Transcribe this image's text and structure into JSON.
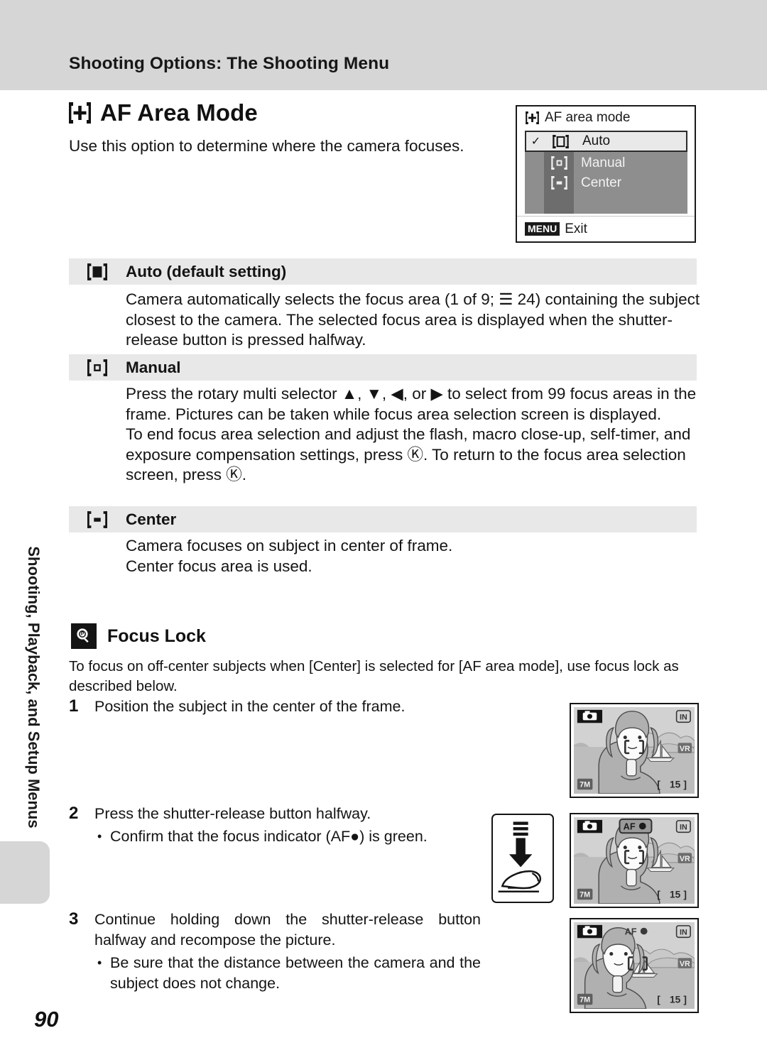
{
  "header": {
    "title": "Shooting Options: The Shooting Menu"
  },
  "sidebar": {
    "vertical_label": "Shooting, Playback, and Setup Menus"
  },
  "page_number": "90",
  "main": {
    "title": "AF Area Mode",
    "title_icon": "af-area-bracket-plus-icon",
    "intro": "Use this option to determine where the camera focuses."
  },
  "camera_menu": {
    "title": "AF area mode",
    "title_icon": "af-area-bracket-plus-icon",
    "items": [
      {
        "label": "Auto",
        "icon": "bracket-large-square-icon",
        "selected": true,
        "check": "✓"
      },
      {
        "label": "Manual",
        "icon": "bracket-small-square-icon",
        "selected": false,
        "check": ""
      },
      {
        "label": "Center",
        "icon": "bracket-dot-rect-icon",
        "selected": false,
        "check": ""
      }
    ],
    "footer_badge": "MENU",
    "footer_label": "Exit"
  },
  "options": [
    {
      "icon": "bracket-filled-square-icon",
      "heading": "Auto (default setting)",
      "body": "Camera automatically selects the focus area (1 of 9; ☰ 24) containing the subject closest to the camera. The selected focus area is displayed when the shutter-release button is pressed halfway."
    },
    {
      "icon": "bracket-small-square-icon",
      "heading": "Manual",
      "body_1": "Press the rotary multi selector ▲, ▼, ◀, or ▶ to select from 99 focus areas in the frame. Pictures can be taken while focus area selection screen is displayed.",
      "body_2": "To end focus area selection and adjust the flash, macro close-up, self-timer, and exposure compensation settings, press Ⓚ. To return to the focus area selection screen, press Ⓚ."
    },
    {
      "icon": "bracket-dot-rect-icon",
      "heading": "Center",
      "body_1": "Camera focuses on subject in center of frame.",
      "body_2": "Center focus area is used."
    }
  ],
  "tip": {
    "icon": "lightbulb-tip-icon",
    "title": "Focus Lock",
    "intro": "To focus on off-center subjects when [Center] is selected for [AF area mode], use focus lock as described below."
  },
  "steps": [
    {
      "number": "1",
      "text": "Position the subject in the center of the frame.",
      "bullets": []
    },
    {
      "number": "2",
      "text": "Press the shutter-release button halfway.",
      "bullets": [
        "Confirm that the focus indicator (AF●) is green."
      ]
    },
    {
      "number": "3",
      "text": "Continue holding down the shutter-release button halfway and recompose the picture.",
      "bullets": [
        "Be sure that the distance between the camera and the subject does not change."
      ]
    }
  ],
  "lcd_screens": [
    {
      "name": "lcd-step-1",
      "mode_icon": "camera-mode-icon",
      "memory_icon": "IN",
      "vr_icon": "VR",
      "image_size": "7M",
      "frames_remaining": "15",
      "af_indicator": "",
      "af_highlighted": false,
      "subject_centered": true
    },
    {
      "name": "lcd-step-2",
      "mode_icon": "camera-mode-icon",
      "memory_icon": "IN",
      "vr_icon": "VR",
      "image_size": "7M",
      "frames_remaining": "15",
      "af_indicator": "AF●",
      "af_highlighted": true,
      "subject_centered": true
    },
    {
      "name": "lcd-step-3",
      "mode_icon": "camera-mode-icon",
      "memory_icon": "IN",
      "vr_icon": "VR",
      "image_size": "7M",
      "frames_remaining": "15",
      "af_indicator": "AF●",
      "af_highlighted": false,
      "subject_centered": false
    }
  ],
  "shutter_illustration": {
    "name": "press-shutter-halfway-illustration"
  },
  "colors": {
    "header_band": "#d6d6d6",
    "section_head": "#e8e8e8",
    "menu_body": "#8e8e8e",
    "menu_icon_col": "#6d6d6d",
    "text": "#141414"
  }
}
